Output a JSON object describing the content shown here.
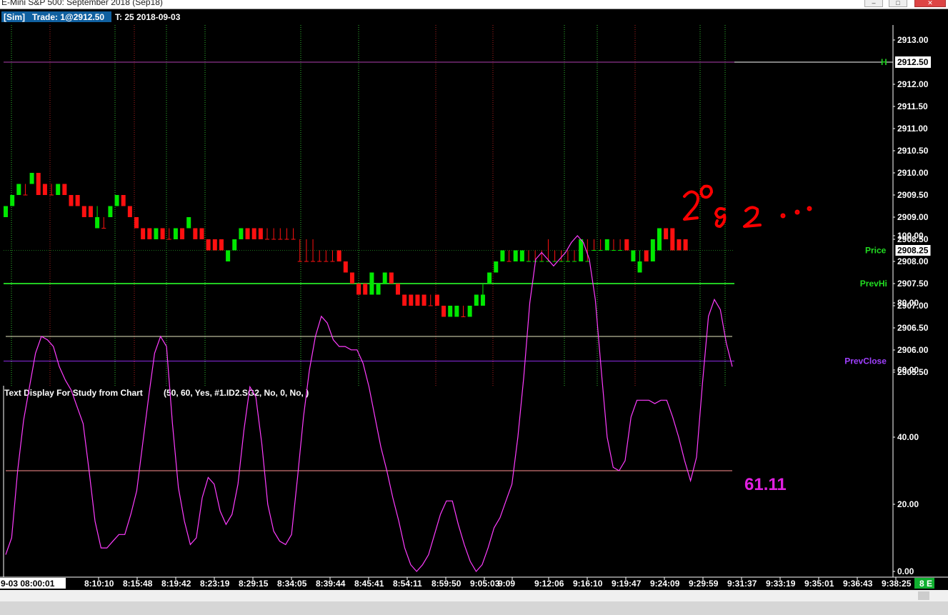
{
  "window": {
    "title": "E-Mini S&P 500: September 2018 (Sep18)",
    "buttons": [
      "–",
      "□",
      "✕"
    ]
  },
  "header": {
    "sim_label": "[Sim]",
    "trade_label": "Trade: 1@2912.50",
    "trade_info": "T: 25 2018-09-03"
  },
  "price_pane": {
    "y_range": [
      2905.25,
      2913.25
    ],
    "y_ticks": [
      "2913.00",
      "2912.50",
      "2912.00",
      "2911.50",
      "2911.00",
      "2910.50",
      "2910.00",
      "2909.50",
      "2909.00",
      "2908.50",
      "2908.25",
      "2908.00",
      "2907.50",
      "2907.00",
      "2906.50",
      "2906.00",
      "2905.50"
    ],
    "lines": [
      {
        "name": "Trade",
        "value": 2912.5,
        "color": "#b040b0",
        "label": "2912.50",
        "tag": "H"
      },
      {
        "name": "Price",
        "value": 2908.25,
        "color": "#1a6e1a",
        "label": "Price",
        "tag": "2908.25"
      },
      {
        "name": "PrevHi",
        "value": 2907.5,
        "color": "#22cc22",
        "label": "PrevHi"
      },
      {
        "name": "PrevClose",
        "value": 2905.75,
        "color": "#8a2be2",
        "label": "PrevClose"
      }
    ],
    "vlines": [
      {
        "i": 0,
        "color": "g"
      },
      {
        "i": 4,
        "color": "r"
      },
      {
        "i": 10,
        "color": "g"
      },
      {
        "i": 13,
        "color": "r"
      },
      {
        "i": 17,
        "color": "g"
      },
      {
        "i": 24,
        "color": "g"
      },
      {
        "i": 34,
        "color": "g"
      },
      {
        "i": 38,
        "color": "g"
      },
      {
        "i": 44,
        "color": "r"
      },
      {
        "i": 47,
        "color": "r"
      },
      {
        "i": 50,
        "color": "g"
      },
      {
        "i": 55,
        "color": "g"
      },
      {
        "i": 57,
        "color": "r"
      }
    ],
    "bars": [
      [
        2909.25,
        2909.0,
        2909.0,
        "up"
      ],
      [
        2909.5,
        2909.25,
        2909.25,
        "up"
      ],
      [
        2909.75,
        2909.5,
        2909.5,
        "up"
      ],
      [
        2909.75,
        2909.75,
        2909.5,
        "flat"
      ],
      [
        2910.0,
        2909.75,
        2909.75,
        "up"
      ],
      [
        2910.0,
        2909.75,
        2909.5,
        "down"
      ],
      [
        2909.75,
        2909.5,
        2909.5,
        "down"
      ],
      [
        2909.75,
        2909.5,
        2909.5,
        "flat"
      ],
      [
        2909.75,
        2909.5,
        2909.5,
        "up"
      ],
      [
        2909.75,
        2909.5,
        2909.5,
        "down"
      ],
      [
        2909.5,
        2909.25,
        2909.25,
        "down"
      ],
      [
        2909.5,
        2909.25,
        2909.25,
        "down"
      ],
      [
        2909.25,
        2909.0,
        2909.0,
        "down"
      ],
      [
        2909.25,
        2909.0,
        2909.0,
        "down"
      ],
      [
        2909.25,
        2908.75,
        2908.75,
        "up"
      ],
      [
        2909.0,
        2908.75,
        2908.75,
        "flat"
      ],
      [
        2909.25,
        2909.0,
        2909.0,
        "up"
      ],
      [
        2909.5,
        2909.25,
        2909.25,
        "up"
      ],
      [
        2909.5,
        2909.25,
        2909.25,
        "down"
      ],
      [
        2909.25,
        2909.0,
        2909.0,
        "down"
      ],
      [
        2909.0,
        2908.75,
        2908.75,
        "down"
      ],
      [
        2908.75,
        2908.5,
        2908.5,
        "down"
      ],
      [
        2908.75,
        2908.5,
        2908.5,
        "down"
      ],
      [
        2908.75,
        2908.5,
        2908.5,
        "up"
      ],
      [
        2908.75,
        2908.5,
        2908.5,
        "down"
      ],
      [
        2908.75,
        2908.5,
        2908.5,
        "flat"
      ],
      [
        2908.75,
        2908.5,
        2908.5,
        "up"
      ],
      [
        2908.75,
        2908.5,
        2908.5,
        "down"
      ],
      [
        2909.0,
        2908.75,
        2908.75,
        "up"
      ],
      [
        2908.75,
        2908.5,
        2908.5,
        "down"
      ],
      [
        2908.75,
        2908.5,
        2908.5,
        "down"
      ],
      [
        2908.5,
        2908.25,
        2908.25,
        "down"
      ],
      [
        2908.5,
        2908.25,
        2908.25,
        "down"
      ],
      [
        2908.5,
        2908.25,
        2908.25,
        "down"
      ],
      [
        2908.25,
        2908.0,
        2908.0,
        "up"
      ],
      [
        2908.5,
        2908.25,
        2908.25,
        "up"
      ],
      [
        2908.75,
        2908.5,
        2908.5,
        "up"
      ],
      [
        2908.75,
        2908.5,
        2908.5,
        "down"
      ],
      [
        2908.75,
        2908.5,
        2908.5,
        "down"
      ],
      [
        2908.75,
        2908.5,
        2908.5,
        "down"
      ],
      [
        2908.75,
        2908.5,
        2908.5,
        "flat"
      ],
      [
        2908.75,
        2908.5,
        2908.5,
        "flat"
      ],
      [
        2908.75,
        2908.5,
        2908.5,
        "flat"
      ],
      [
        2908.75,
        2908.5,
        2908.5,
        "flat"
      ],
      [
        2908.75,
        2908.5,
        2908.5,
        "flat"
      ],
      [
        2908.5,
        2908.25,
        2908.0,
        "flat"
      ],
      [
        2908.5,
        2908.25,
        2908.0,
        "flat"
      ],
      [
        2908.5,
        2908.25,
        2908.0,
        "flat"
      ],
      [
        2908.25,
        2908.0,
        2908.0,
        "flat"
      ],
      [
        2908.25,
        2908.0,
        2908.0,
        "flat"
      ],
      [
        2908.25,
        2908.0,
        2908.0,
        "flat"
      ],
      [
        2908.25,
        2908.0,
        2908.0,
        "down"
      ],
      [
        2908.0,
        2907.75,
        2907.75,
        "down"
      ],
      [
        2907.75,
        2907.5,
        2907.5,
        "down"
      ],
      [
        2907.5,
        2907.25,
        2907.25,
        "down"
      ],
      [
        2907.5,
        2907.25,
        2907.25,
        "down"
      ],
      [
        2907.75,
        2907.5,
        2907.25,
        "up"
      ],
      [
        2907.5,
        2907.25,
        2907.25,
        "up"
      ],
      [
        2907.75,
        2907.5,
        2907.5,
        "up"
      ],
      [
        2907.75,
        2907.5,
        2907.5,
        "down"
      ],
      [
        2907.5,
        2907.25,
        2907.25,
        "down"
      ],
      [
        2907.25,
        2907.0,
        2907.0,
        "down"
      ],
      [
        2907.25,
        2907.0,
        2907.0,
        "down"
      ],
      [
        2907.25,
        2907.0,
        2907.0,
        "down"
      ],
      [
        2907.25,
        2907.0,
        2907.0,
        "down"
      ],
      [
        2907.25,
        2907.0,
        2907.0,
        "flat"
      ],
      [
        2907.25,
        2907.0,
        2907.0,
        "down"
      ],
      [
        2907.0,
        2906.75,
        2906.75,
        "down"
      ],
      [
        2907.0,
        2906.75,
        2906.75,
        "up"
      ],
      [
        2907.0,
        2906.75,
        2906.75,
        "up"
      ],
      [
        2907.0,
        2906.75,
        2906.75,
        "flat"
      ],
      [
        2907.0,
        2906.75,
        2906.75,
        "up"
      ],
      [
        2907.25,
        2907.0,
        2907.0,
        "up"
      ],
      [
        2907.5,
        2907.0,
        2907.0,
        "up"
      ],
      [
        2907.75,
        2907.5,
        2907.5,
        "up"
      ],
      [
        2908.0,
        2907.75,
        2907.75,
        "up"
      ],
      [
        2908.25,
        2908.0,
        2908.0,
        "up"
      ],
      [
        2908.25,
        2908.0,
        2908.0,
        "flat"
      ],
      [
        2908.25,
        2908.0,
        2908.0,
        "up"
      ],
      [
        2908.25,
        2908.0,
        2908.0,
        "up"
      ],
      [
        2908.25,
        2908.25,
        2908.0,
        "flat"
      ],
      [
        2908.25,
        2908.25,
        2908.0,
        "flat"
      ],
      [
        2908.25,
        2908.25,
        2908.0,
        "flat"
      ],
      [
        2908.5,
        2908.25,
        2908.0,
        "flat"
      ],
      [
        2908.25,
        2908.0,
        2908.0,
        "flat"
      ],
      [
        2908.25,
        2908.0,
        2908.0,
        "flat"
      ],
      [
        2908.25,
        2908.0,
        2908.0,
        "flat"
      ],
      [
        2908.25,
        2908.0,
        2908.0,
        "flat"
      ],
      [
        2908.5,
        2908.25,
        2908.0,
        "up"
      ],
      [
        2908.5,
        2908.25,
        2908.0,
        "flat"
      ],
      [
        2908.5,
        2908.25,
        2908.25,
        "flat"
      ],
      [
        2908.5,
        2908.25,
        2908.25,
        "flat"
      ],
      [
        2908.5,
        2908.25,
        2908.25,
        "up"
      ],
      [
        2908.5,
        2908.25,
        2908.25,
        "flat"
      ],
      [
        2908.5,
        2908.25,
        2908.25,
        "flat"
      ],
      [
        2908.5,
        2908.25,
        2908.25,
        "down"
      ],
      [
        2908.25,
        2908.0,
        2908.0,
        "up"
      ],
      [
        2908.25,
        2907.75,
        2907.75,
        "up"
      ],
      [
        2908.25,
        2908.0,
        2908.0,
        "down"
      ],
      [
        2908.5,
        2908.25,
        2908.0,
        "up"
      ],
      [
        2908.75,
        2908.5,
        2908.25,
        "up"
      ],
      [
        2908.75,
        2908.5,
        2908.5,
        "down"
      ],
      [
        2908.75,
        2908.5,
        2908.25,
        "down"
      ],
      [
        2908.5,
        2908.25,
        2908.25,
        "down"
      ],
      [
        2908.5,
        2908.25,
        2908.25,
        "down"
      ]
    ],
    "annotation": "20 82 ..."
  },
  "study_pane": {
    "label": "Text Display For Study from Chart",
    "params": "(50, 60, Yes, #1.ID2.SG2, No, 0, No, )",
    "y_range": [
      0,
      100
    ],
    "y_ticks": [
      "100.00",
      "80.00",
      "60.00",
      "40.00",
      "20.00",
      "0.00"
    ],
    "upper_level": 70,
    "lower_level": 30,
    "value_display": "61.11",
    "series": [
      5,
      10,
      30,
      45,
      55,
      65,
      70,
      69,
      67,
      61,
      57,
      54,
      49,
      44,
      30,
      15,
      7,
      7,
      9,
      11,
      11,
      17,
      24,
      38,
      52,
      65,
      70,
      67,
      44,
      25,
      15,
      8,
      10,
      22,
      28,
      26,
      18,
      14,
      17,
      26,
      42,
      55,
      52,
      38,
      20,
      12,
      9,
      8,
      11,
      28,
      46,
      60,
      70,
      76,
      74,
      69,
      67,
      67,
      66,
      66,
      62,
      55,
      46,
      37,
      30,
      22,
      15,
      7,
      2,
      0,
      2,
      5,
      11,
      17,
      21,
      21,
      14,
      8,
      3,
      0,
      2,
      7,
      13,
      16,
      21,
      26,
      40,
      58,
      80,
      93,
      95,
      93,
      91,
      93,
      95,
      98,
      100,
      98,
      93,
      81,
      60,
      40,
      31,
      30,
      33,
      46,
      51,
      51,
      51,
      50,
      51,
      51,
      46,
      40,
      33,
      27,
      34,
      56,
      76,
      81,
      78,
      68,
      61
    ]
  },
  "time_axis": {
    "labels": [
      "9-03  08:00:01",
      "8:10:10",
      "8:15:48",
      "8:19:42",
      "8:23:19",
      "8:29:15",
      "8:34:05",
      "8:39:44",
      "8:45:41",
      "8:54:11",
      "8:59:50",
      "9:05:03",
      "9:09",
      "9:12:06",
      "9:16:10",
      "9:19:47",
      "9:24:09",
      "9:29:59",
      "9:31:37",
      "9:33:19",
      "9:35:01",
      "9:36:43",
      "9:38:25"
    ],
    "corner_badge": "8 E"
  },
  "colors": {
    "up": "#00e800",
    "down": "#ff1010",
    "grid_green": "#2fbf2f",
    "grid_red": "#b02020",
    "study_line": "#ff3cff",
    "study_value": "#e020e0",
    "level_upper": "#e8e8c0",
    "level_lower": "#ff9090",
    "annotation": "#ff0000"
  }
}
